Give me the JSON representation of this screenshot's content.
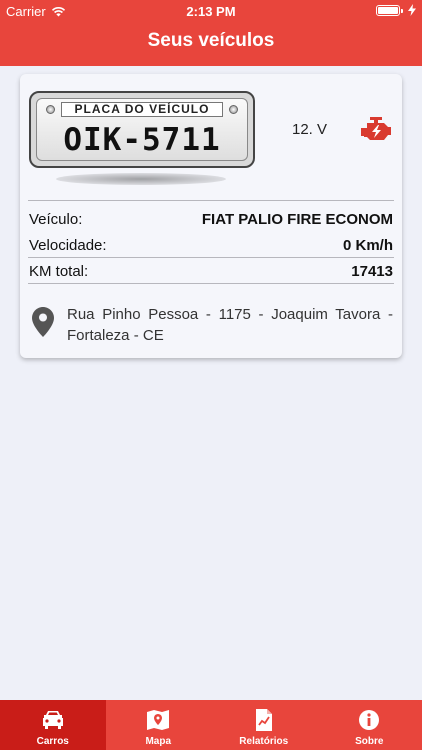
{
  "status_bar": {
    "carrier": "Carrier",
    "time": "2:13 PM"
  },
  "header": {
    "title": "Seus veículos"
  },
  "vehicle": {
    "plate_header": "PLACA DO VEÍCULO",
    "plate_number": "OIK-5711",
    "voltage": "12. V",
    "rows": [
      {
        "label": "Veículo:",
        "value": "FIAT PALIO FIRE ECONOM"
      },
      {
        "label": "Velocidade:",
        "value": "0 Km/h"
      },
      {
        "label": "KM total:",
        "value": "17413"
      }
    ],
    "address": "Rua Pinho Pessoa - 1175 - Joaquim Tavora - Fortaleza - CE"
  },
  "tabs": [
    {
      "label": "Carros",
      "icon": "car-icon",
      "active": true
    },
    {
      "label": "Mapa",
      "icon": "map-icon",
      "active": false
    },
    {
      "label": "Relatórios",
      "icon": "report-icon",
      "active": false
    },
    {
      "label": "Sobre",
      "icon": "info-icon",
      "active": false
    }
  ],
  "colors": {
    "accent": "#e8453c",
    "active_tab": "#c91d18",
    "engine_icon": "#d93a2f"
  }
}
